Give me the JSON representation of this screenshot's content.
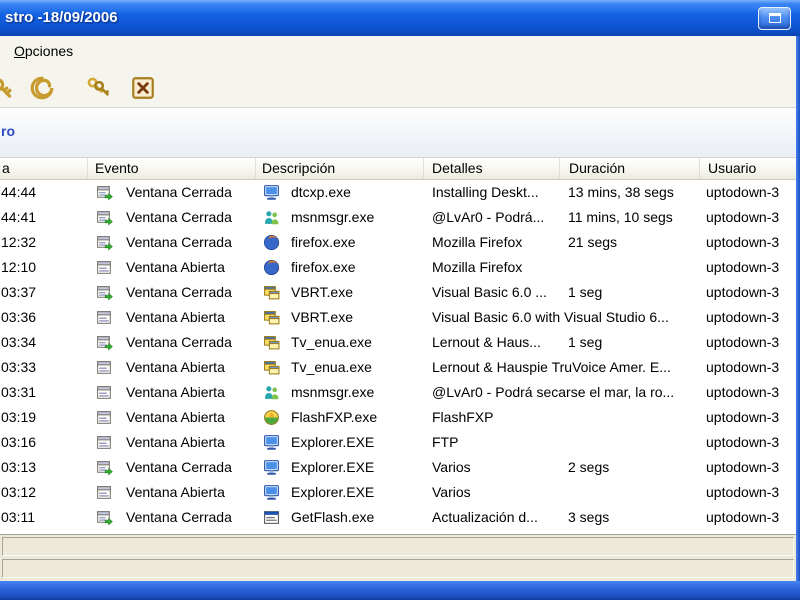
{
  "colors": {
    "titlebar_blue": "#1563e6",
    "frame_blue": "#2b62d8",
    "accent_text_blue": "#2f4cc4",
    "body_bg": "#f5f4ed",
    "list_bg": "#ffffff"
  },
  "titlebar": {
    "title": "stro -18/09/2006",
    "maximize_icon": "maximize-icon"
  },
  "menubar": {
    "items": [
      {
        "accel": "O",
        "rest": "pciones"
      }
    ]
  },
  "toolbar": {
    "buttons": [
      {
        "icon": "key-icon"
      },
      {
        "icon": "shell-icon"
      },
      {
        "icon": "keys-icon"
      },
      {
        "icon": "exit-icon"
      }
    ]
  },
  "filter": {
    "label": "ro"
  },
  "table": {
    "columns": [
      {
        "label": "a"
      },
      {
        "label": "Evento"
      },
      {
        "label": "Descripción"
      },
      {
        "label": "Detalles"
      },
      {
        "label": "Duración"
      },
      {
        "label": "Usuario"
      }
    ],
    "rows": [
      {
        "time": "44:44",
        "event": "Ventana Cerrada",
        "event_icon": "window-closed-icon",
        "app": "dtcxp.exe",
        "app_icon": "computer-icon",
        "details": "Installing Deskt...",
        "duration": "13 mins, 38 segs",
        "user": "uptodown-3"
      },
      {
        "time": "44:41",
        "event": "Ventana Cerrada",
        "event_icon": "window-closed-icon",
        "app": "msnmsgr.exe",
        "app_icon": "msn-icon",
        "details": "@LvAr0 - Podrá...",
        "duration": "11 mins, 10 segs",
        "user": "uptodown-3"
      },
      {
        "time": "12:32",
        "event": "Ventana Cerrada",
        "event_icon": "window-closed-icon",
        "app": "firefox.exe",
        "app_icon": "firefox-icon",
        "details": "Mozilla Firefox",
        "duration": "21 segs",
        "user": "uptodown-3"
      },
      {
        "time": "12:10",
        "event": "Ventana Abierta",
        "event_icon": "window-opened-icon",
        "app": "firefox.exe",
        "app_icon": "firefox-icon",
        "details": "Mozilla Firefox",
        "duration": "",
        "user": "uptodown-3"
      },
      {
        "time": "03:37",
        "event": "Ventana Cerrada",
        "event_icon": "window-closed-icon",
        "app": "VBRT.exe",
        "app_icon": "vb-form-icon",
        "details": "Visual Basic 6.0 ...",
        "duration": "1 seg",
        "user": "uptodown-3"
      },
      {
        "time": "03:36",
        "event": "Ventana Abierta",
        "event_icon": "window-opened-icon",
        "app": "VBRT.exe",
        "app_icon": "vb-form-icon",
        "details": "Visual Basic 6.0 with Visual Studio 6...",
        "duration": "",
        "user": "uptodown-3"
      },
      {
        "time": "03:34",
        "event": "Ventana Cerrada",
        "event_icon": "window-closed-icon",
        "app": "Tv_enua.exe",
        "app_icon": "vb-form-icon",
        "details": "Lernout & Haus...",
        "duration": "1 seg",
        "user": "uptodown-3"
      },
      {
        "time": "03:33",
        "event": "Ventana Abierta",
        "event_icon": "window-opened-icon",
        "app": "Tv_enua.exe",
        "app_icon": "vb-form-icon",
        "details": "Lernout & Hauspie TruVoice Amer. E...",
        "duration": "",
        "user": "uptodown-3"
      },
      {
        "time": "03:31",
        "event": "Ventana Abierta",
        "event_icon": "window-opened-icon",
        "app": "msnmsgr.exe",
        "app_icon": "msn-icon",
        "details": "@LvAr0 - Podrá secarse el mar, la ro...",
        "duration": "",
        "user": "uptodown-3"
      },
      {
        "time": "03:19",
        "event": "Ventana Abierta",
        "event_icon": "window-opened-icon",
        "app": "FlashFXP.exe",
        "app_icon": "flashfxp-icon",
        "details": "FlashFXP",
        "duration": "",
        "user": "uptodown-3"
      },
      {
        "time": "03:16",
        "event": "Ventana Abierta",
        "event_icon": "window-opened-icon",
        "app": "Explorer.EXE",
        "app_icon": "computer-icon",
        "details": "FTP",
        "duration": "",
        "user": "uptodown-3"
      },
      {
        "time": "03:13",
        "event": "Ventana Cerrada",
        "event_icon": "window-closed-icon",
        "app": "Explorer.EXE",
        "app_icon": "computer-icon",
        "details": "Varios",
        "duration": "2 segs",
        "user": "uptodown-3"
      },
      {
        "time": "03:12",
        "event": "Ventana Abierta",
        "event_icon": "window-opened-icon",
        "app": "Explorer.EXE",
        "app_icon": "computer-icon",
        "details": "Varios",
        "duration": "",
        "user": "uptodown-3"
      },
      {
        "time": "03:11",
        "event": "Ventana Cerrada",
        "event_icon": "window-closed-icon",
        "app": "GetFlash.exe",
        "app_icon": "getflash-icon",
        "details": "Actualización d...",
        "duration": "3 segs",
        "user": "uptodown-3"
      }
    ]
  }
}
